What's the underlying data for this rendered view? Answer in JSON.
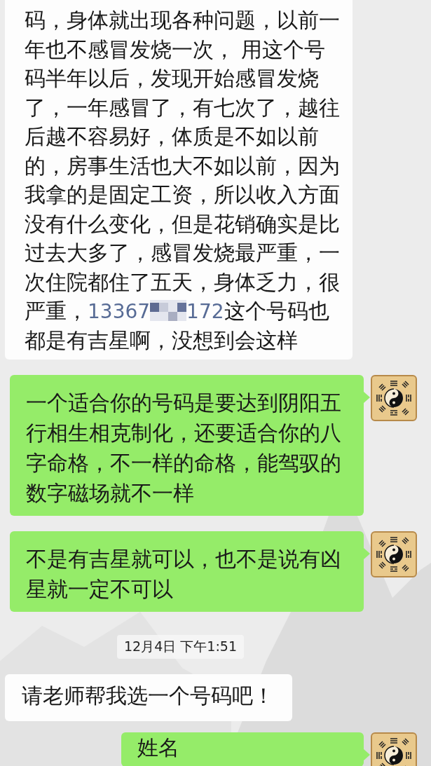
{
  "messages": [
    {
      "kind": "text",
      "mine": false,
      "segments": [
        {
          "kind": "plain",
          "text": "码，身体就出现各种问题，以前一年也不感冒发烧一次， 用这个号码半年以后，发现开始感冒发烧了，一年感冒了，有七次了，越往后越不容易好，体质是不如以前的，房事生活也大不如以前，因为我拿的是固定工资，所以收入方面没有什么变化，但是花销确实是比过去大多了，感冒发烧最严重，一次住院都住了五天，身体乏力，很严重，"
        },
        {
          "kind": "phone",
          "text": "13367"
        },
        {
          "kind": "mosaic"
        },
        {
          "kind": "phone",
          "text": "172"
        },
        {
          "kind": "plain",
          "text": "这个号码也都是有吉星啊，没想到会这样"
        }
      ]
    },
    {
      "kind": "text",
      "mine": true,
      "segments": [
        {
          "kind": "plain",
          "text": "一个适合你的号码是要达到阴阳五行相生相克制化，还要适合你的八字命格，不一样的命格，能驾驭的数字磁场就不一样"
        }
      ]
    },
    {
      "kind": "text",
      "mine": true,
      "segments": [
        {
          "kind": "plain",
          "text": "不是有吉星就可以，也不是说有凶星就一定不可以"
        }
      ]
    },
    {
      "kind": "timestamp",
      "text": "12月4日 下午1:51"
    },
    {
      "kind": "text",
      "mine": false,
      "segments": [
        {
          "kind": "plain",
          "text": "请老师帮我选一个号码吧！"
        }
      ]
    },
    {
      "kind": "text",
      "mine": true,
      "segments": [
        {
          "kind": "plain",
          "text": "姓名"
        }
      ]
    }
  ]
}
